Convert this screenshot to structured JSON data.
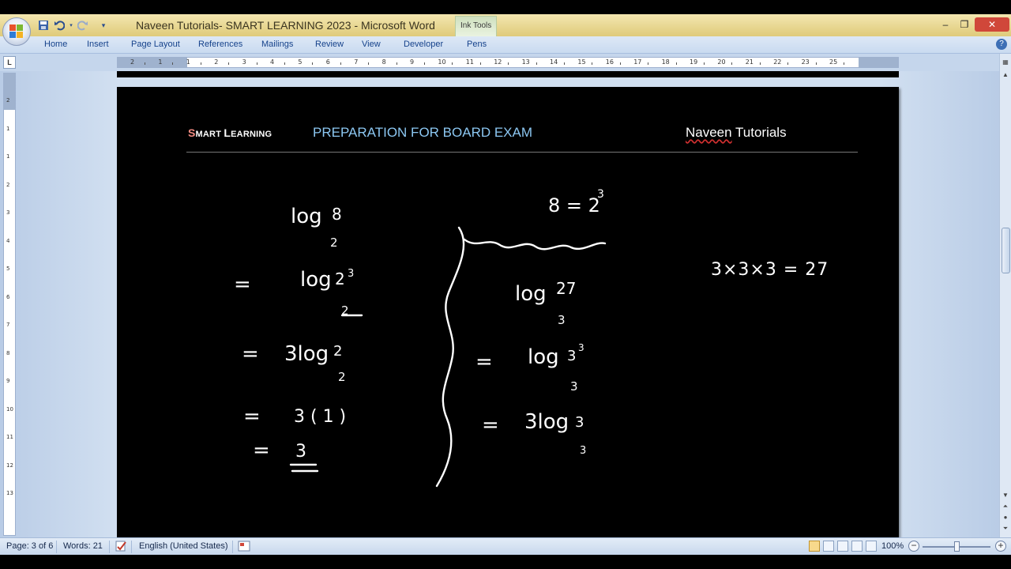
{
  "window": {
    "title": "Naveen Tutorials- SMART LEARNING 2023 - Microsoft Word",
    "contextual_tab_group": "Ink Tools",
    "controls": [
      "–",
      "❐",
      "✕"
    ]
  },
  "quick_access": [
    "save-icon",
    "undo-icon",
    "redo-icon",
    "customize-icon"
  ],
  "ribbon": {
    "tabs": [
      "Home",
      "Insert",
      "Page Layout",
      "References",
      "Mailings",
      "Review",
      "View",
      "Developer",
      "Pens"
    ],
    "help": "?"
  },
  "ruler": {
    "tab_selector": "L",
    "h_numbers": [
      "2",
      "1",
      "1",
      "2",
      "3",
      "4",
      "5",
      "6",
      "7",
      "8",
      "9",
      "10",
      "11",
      "12",
      "13",
      "14",
      "15",
      "16",
      "17",
      "18",
      "19",
      "20",
      "21",
      "22",
      "23",
      "25"
    ],
    "v_numbers": [
      "2",
      "1",
      "1",
      "2",
      "3",
      "4",
      "5",
      "6",
      "7",
      "8",
      "9",
      "10",
      "11",
      "12",
      "13"
    ]
  },
  "document": {
    "header_left_cap1": "S",
    "header_left_rest1": "MART ",
    "header_left_cap2": "L",
    "header_left_rest2": "EARNING",
    "header_mid": "PREPARATION FOR BOARD EXAM",
    "header_right_a": "Naveen",
    "header_right_b": " Tutorials",
    "ink": {
      "left": {
        "line1_log": "log",
        "line1_arg": "8",
        "line1_base": "2",
        "eq": "=",
        "line2_log": "log",
        "line2_arg": "2",
        "line2_exp": "3",
        "line2_base": "2",
        "line3_coef": "3log",
        "line3_arg": "2",
        "line3_base": "2",
        "line4": "3 ( 1 )",
        "line5": "3"
      },
      "middle": {
        "top": "8 = 2",
        "top_exp": "3",
        "line1_log": "log",
        "line1_arg": "27",
        "line1_base": "3",
        "line2_log": "log",
        "line2_arg": "3",
        "line2_exp": "3",
        "line2_base": "3",
        "line3_coef": "3log",
        "line3_arg": "3",
        "line3_base": "3"
      },
      "right": {
        "expr": "3×3×3 = 27"
      }
    }
  },
  "statusbar": {
    "page": "Page: 3 of 6",
    "words": "Words: 21",
    "language": "English (United States)",
    "zoom": "100%",
    "zoom_out": "−",
    "zoom_in": "+"
  },
  "colors": {
    "titlebar": "#dfcb7a",
    "ribbon": "#c9daf0",
    "page": "#000000",
    "header_mid": "#8cc7f2",
    "header_cap": "#f08a80",
    "close_button": "#d0473a"
  }
}
